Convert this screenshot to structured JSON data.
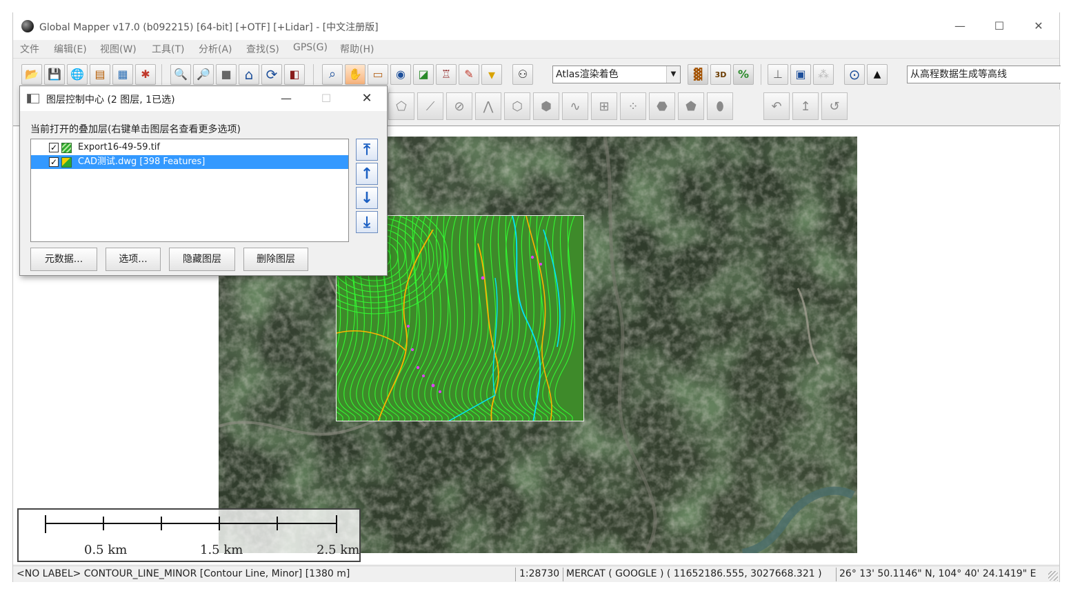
{
  "window": {
    "title": "Global Mapper v17.0 (b092215) [64-bit] [+OTF] [+Lidar] - [中文注册版]",
    "minimize_glyph": "—",
    "maximize_glyph": "☐",
    "close_glyph": "✕"
  },
  "menu": [
    "文件",
    "编辑(E)",
    "视图(W)",
    "工具(T)",
    "分析(A)",
    "查找(S)",
    "GPS(G)",
    "帮助(H)"
  ],
  "toolbar": {
    "icons": [
      {
        "name": "open-folder-icon",
        "glyph": "📂"
      },
      {
        "name": "save-icon",
        "glyph": "💾"
      },
      {
        "name": "globe-icon",
        "glyph": "🌐"
      },
      {
        "name": "layer-control-icon",
        "glyph": "▤"
      },
      {
        "name": "overlay-config-icon",
        "glyph": "▦"
      },
      {
        "name": "tools-icon",
        "glyph": "✱"
      },
      {
        "name": "zoom-in-icon",
        "glyph": "🔍"
      },
      {
        "name": "zoom-out-icon",
        "glyph": "🔎"
      },
      {
        "name": "pan-icon",
        "glyph": "■"
      },
      {
        "name": "home-icon",
        "glyph": "⌂"
      },
      {
        "name": "refresh-icon",
        "glyph": "⟳"
      },
      {
        "name": "full-view-icon",
        "glyph": "◧"
      },
      {
        "name": "info-tool-icon",
        "glyph": "⌕"
      },
      {
        "name": "hand-tool-icon",
        "glyph": "✋"
      },
      {
        "name": "measure-icon",
        "glyph": "▭"
      },
      {
        "name": "feature-info-icon",
        "glyph": "◉"
      },
      {
        "name": "area-icon",
        "glyph": "◪"
      },
      {
        "name": "tower-icon",
        "glyph": "♖"
      },
      {
        "name": "draw-icon",
        "glyph": "✎"
      },
      {
        "name": "dropdown-tool-icon",
        "glyph": "▾"
      },
      {
        "name": "binoculars-icon",
        "glyph": "⚇"
      }
    ],
    "render_mode": "Atlas渲染着色",
    "render_arrow": "▼",
    "view_icons": [
      {
        "name": "shader-icon",
        "glyph": "▓"
      },
      {
        "name": "3d-view-icon",
        "glyph": "3D"
      },
      {
        "name": "3d-percent-icon",
        "glyph": "%"
      }
    ],
    "extra_icons": [
      {
        "name": "profile-icon",
        "glyph": "⊥"
      },
      {
        "name": "layer-stack-icon",
        "glyph": "▣"
      },
      {
        "name": "lidar-icon",
        "glyph": "⁂"
      },
      {
        "name": "gps-center-icon",
        "glyph": "⊙"
      },
      {
        "name": "north-arrow-icon",
        "glyph": "▲"
      }
    ],
    "contour_action": "从高程数据生成等高线"
  },
  "toolbar2_icons": [
    {
      "name": "digitize-area-icon",
      "glyph": "⬠"
    },
    {
      "name": "edit-line-icon",
      "glyph": "⟋"
    },
    {
      "name": "rotate-feature-icon",
      "glyph": "⊘"
    },
    {
      "name": "move-vertex-icon",
      "glyph": "⋀"
    },
    {
      "name": "buffer-icon",
      "glyph": "⬡"
    },
    {
      "name": "split-icon",
      "glyph": "⬢"
    },
    {
      "name": "smooth-icon",
      "glyph": "∿"
    },
    {
      "name": "grid-icon",
      "glyph": "⊞"
    },
    {
      "name": "points-icon",
      "glyph": "⁘"
    },
    {
      "name": "fill-area-icon",
      "glyph": "⬣"
    },
    {
      "name": "merge-icon",
      "glyph": "⬟"
    },
    {
      "name": "shape-icon",
      "glyph": "⬮"
    },
    {
      "name": "undo-vertex-icon",
      "glyph": "↶"
    },
    {
      "name": "redo-vertex-icon",
      "glyph": "↥"
    },
    {
      "name": "reverse-icon",
      "glyph": "↺"
    }
  ],
  "layer_dialog": {
    "title": "图层控制中心 (2 图层, 1已选)",
    "caption": "当前打开的叠加层(右键单击图层名查看更多选项)",
    "minimize_glyph": "—",
    "maximize_glyph": "☐",
    "close_glyph": "✕",
    "check_glyph": "✓",
    "layers": [
      {
        "name": "Export16-49-59.tif",
        "checked": true,
        "selected": false
      },
      {
        "name": "CAD测试.dwg [398 Features]",
        "checked": true,
        "selected": true
      }
    ],
    "arrows": {
      "move_top": "⤒",
      "move_up": "↑",
      "move_down": "↓",
      "move_bottom": "⤓"
    },
    "buttons": [
      "元数据...",
      "选项...",
      "隐藏图层",
      "删除图层"
    ]
  },
  "scale_bar": {
    "labels": [
      "0.5 km",
      "1.5 km",
      "2.5 km"
    ]
  },
  "status": {
    "feature": "<NO LABEL> CONTOUR_LINE_MINOR [Contour Line, Minor] [1380 m]",
    "scale": "1:28730",
    "projection": "MERCAT ( GOOGLE ) ( 11652186.555, 3027668.321 )",
    "latlon": "26° 13' 50.1146\" N, 104° 40' 24.1419\" E"
  },
  "colors": {
    "selection": "#3399ff",
    "contour_line": "#33ff33",
    "index_contour": "#ffb300",
    "stream": "#00e5ff",
    "marker": "#e040fb"
  }
}
